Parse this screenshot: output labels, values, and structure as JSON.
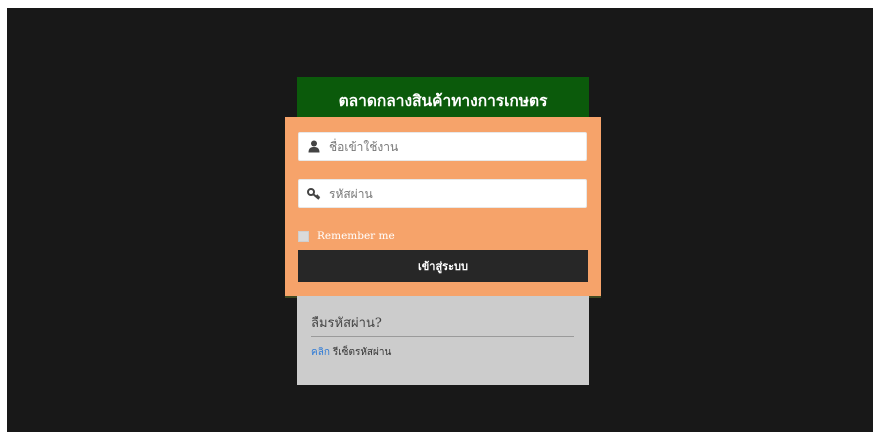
{
  "header": {
    "title": "ตลาดกลางสินค้าทางการเกษตร"
  },
  "login": {
    "username_placeholder": "ชื่อเข้าใช้งาน",
    "username_icon": "user-icon",
    "password_placeholder": "รหัสผ่าน",
    "password_icon": "key-icon",
    "remember_label": "Remember me",
    "submit_label": "เข้าสู่ระบบ"
  },
  "forgot": {
    "title": "ลืมรหัสผ่าน?",
    "link_label": "คลิก",
    "reset_text": "รีเซ็ตรหัสผ่าน"
  },
  "colors": {
    "background": "#181818",
    "header": "#0b5a0b",
    "panel": "#f6a36a",
    "button": "#272727",
    "footer_panel": "#cccccc",
    "link": "#2f7bd6"
  }
}
